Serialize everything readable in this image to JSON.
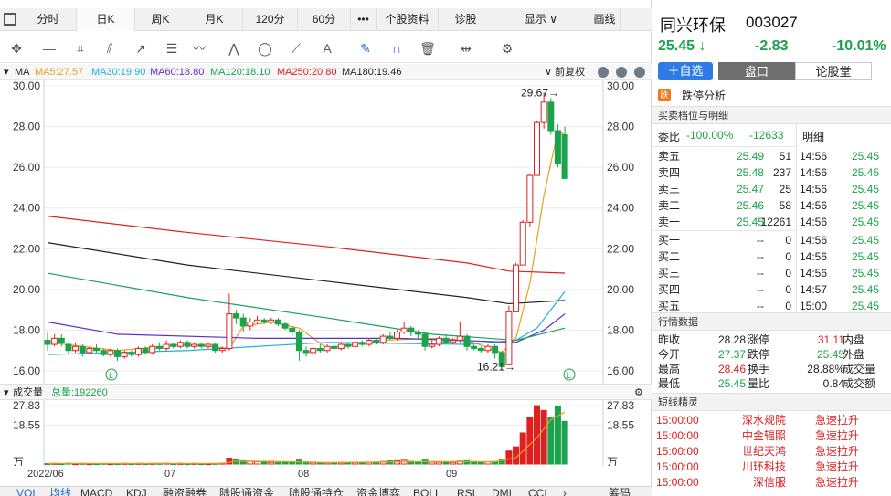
{
  "colors": {
    "up": "#e0201f",
    "down": "#1aa34a",
    "accent": "#2f7be6"
  },
  "period_tabs": [
    {
      "label": "分时"
    },
    {
      "label": "日K",
      "active": true
    },
    {
      "label": "周K"
    },
    {
      "label": "月K"
    },
    {
      "label": "120分"
    },
    {
      "label": "60分"
    },
    {
      "label": "•••"
    },
    {
      "label": "个股资料"
    },
    {
      "label": "诊股"
    },
    {
      "label": "显示 ∨"
    },
    {
      "label": "画线"
    }
  ],
  "drawing_tools": [
    "crosshair-icon",
    "segment-icon",
    "rectangle-icon",
    "channel-icon",
    "ray-icon",
    "parallel-icon",
    "text-icon",
    "polyline-icon",
    "ellipse-icon",
    "fibonacci-icon",
    "annotation-icon",
    "brush-icon",
    "magnet-icon",
    "trash-icon",
    "split-icon",
    "settings-icon"
  ],
  "ma_bar": {
    "label": "MA",
    "items": [
      {
        "text": "MA5:27.57",
        "color": "#e6a01e"
      },
      {
        "text": "MA30:19.90",
        "color": "#19b6d8"
      },
      {
        "text": "MA60:18.80",
        "color": "#5a30c8"
      },
      {
        "text": "MA120:18.10",
        "color": "#19a25a"
      },
      {
        "text": "MA250:20.80",
        "color": "#e0201f"
      },
      {
        "text": "MA180:19.46",
        "color": "#222222"
      }
    ],
    "adjust_label": "∨ 前复权"
  },
  "price_axis": {
    "ticks": [
      "30.00",
      "28.00",
      "26.00",
      "24.00",
      "22.00",
      "20.00",
      "18.00",
      "16.00"
    ]
  },
  "annotations": {
    "high": "29.67→",
    "low": "16.21→"
  },
  "volume_bar": {
    "label": "成交量",
    "total": "总量:192260"
  },
  "volume_axis": {
    "ticks": [
      "27.83",
      "18.55",
      "万"
    ]
  },
  "date_axis": [
    "2022/06",
    "07",
    "08",
    "09"
  ],
  "indicator_tabs": [
    "VOL",
    "均线",
    "MACD",
    "KDJ",
    "融资融券",
    "陆股通资金",
    "陆股通持仓",
    "资金博弈",
    "BOLL",
    "RSI",
    "DMI",
    "CCI",
    "›",
    "筹码"
  ],
  "chart_data": {
    "type": "candlestick",
    "ylim": [
      16,
      30
    ],
    "candles": [
      [
        17.5,
        17.3,
        17.9,
        17.0
      ],
      [
        17.3,
        17.6,
        17.8,
        17.2
      ],
      [
        17.6,
        17.4,
        17.8,
        17.2
      ],
      [
        17.3,
        17.0,
        17.4,
        16.8
      ],
      [
        17.0,
        17.2,
        17.4,
        16.9
      ],
      [
        17.2,
        16.9,
        17.3,
        16.7
      ],
      [
        16.9,
        17.1,
        17.2,
        16.8
      ],
      [
        17.1,
        17.0,
        17.3,
        16.9
      ],
      [
        17.0,
        16.8,
        17.1,
        16.7
      ],
      [
        16.8,
        17.0,
        17.1,
        16.7
      ],
      [
        17.0,
        16.7,
        17.1,
        16.5
      ],
      [
        16.7,
        16.9,
        17.0,
        16.6
      ],
      [
        16.9,
        16.8,
        17.0,
        16.7
      ],
      [
        16.8,
        17.1,
        17.2,
        16.7
      ],
      [
        17.1,
        16.9,
        17.2,
        16.8
      ],
      [
        16.9,
        17.2,
        17.3,
        16.8
      ],
      [
        17.2,
        17.1,
        17.4,
        17.0
      ],
      [
        17.1,
        17.3,
        17.5,
        17.0
      ],
      [
        17.3,
        17.2,
        17.4,
        17.1
      ],
      [
        17.2,
        17.4,
        17.5,
        17.1
      ],
      [
        17.4,
        17.2,
        17.5,
        17.1
      ],
      [
        17.2,
        17.3,
        17.4,
        17.1
      ],
      [
        17.3,
        17.2,
        17.4,
        17.1
      ],
      [
        17.2,
        17.3,
        17.4,
        17.1
      ],
      [
        17.3,
        17.0,
        17.4,
        16.9
      ],
      [
        17.0,
        17.1,
        17.2,
        16.9
      ],
      [
        17.1,
        18.8,
        19.8,
        17.0
      ],
      [
        18.8,
        18.6,
        19.0,
        18.3
      ],
      [
        18.6,
        18.2,
        18.8,
        17.9
      ],
      [
        18.2,
        18.4,
        18.6,
        18.0
      ],
      [
        18.4,
        18.5,
        18.7,
        18.3
      ],
      [
        18.5,
        18.4,
        18.6,
        18.3
      ],
      [
        18.4,
        18.5,
        18.6,
        18.3
      ],
      [
        18.5,
        18.3,
        18.6,
        18.2
      ],
      [
        18.3,
        18.1,
        18.4,
        18.0
      ],
      [
        18.1,
        17.9,
        18.2,
        17.7
      ],
      [
        17.9,
        17.0,
        18.0,
        16.5
      ],
      [
        17.0,
        16.9,
        17.2,
        16.7
      ],
      [
        16.9,
        17.1,
        17.2,
        16.8
      ],
      [
        17.1,
        17.0,
        17.3,
        16.9
      ],
      [
        17.0,
        17.2,
        17.3,
        16.9
      ],
      [
        17.2,
        17.1,
        17.3,
        17.0
      ],
      [
        17.1,
        17.3,
        17.4,
        17.0
      ],
      [
        17.3,
        17.2,
        17.4,
        17.1
      ],
      [
        17.2,
        17.4,
        17.5,
        17.1
      ],
      [
        17.4,
        17.3,
        17.5,
        17.2
      ],
      [
        17.3,
        17.5,
        17.6,
        17.2
      ],
      [
        17.5,
        17.4,
        17.6,
        17.3
      ],
      [
        17.4,
        17.7,
        17.8,
        17.3
      ],
      [
        17.7,
        17.6,
        17.9,
        17.5
      ],
      [
        17.6,
        17.9,
        18.0,
        17.5
      ],
      [
        17.9,
        18.1,
        18.4,
        17.8
      ],
      [
        18.1,
        17.9,
        18.2,
        17.7
      ],
      [
        17.9,
        17.8,
        18.0,
        17.6
      ],
      [
        17.8,
        17.2,
        17.9,
        17.0
      ],
      [
        17.2,
        17.3,
        17.5,
        17.1
      ],
      [
        17.3,
        17.6,
        17.7,
        17.2
      ],
      [
        17.6,
        17.4,
        17.8,
        17.3
      ],
      [
        17.4,
        17.5,
        17.6,
        17.3
      ],
      [
        17.5,
        17.7,
        18.4,
        17.4
      ],
      [
        17.7,
        17.2,
        17.8,
        17.0
      ],
      [
        17.2,
        17.1,
        17.3,
        17.0
      ],
      [
        17.1,
        17.0,
        17.2,
        16.9
      ],
      [
        17.0,
        17.2,
        17.3,
        16.9
      ],
      [
        17.2,
        16.9,
        17.3,
        16.6
      ],
      [
        16.9,
        16.21,
        17.0,
        16.21
      ],
      [
        16.3,
        18.9,
        19.2,
        16.3
      ],
      [
        18.9,
        21.2,
        21.3,
        18.9
      ],
      [
        21.2,
        23.3,
        23.4,
        21.2
      ],
      [
        23.3,
        25.6,
        25.7,
        23.1
      ],
      [
        25.6,
        28.2,
        28.3,
        25.6
      ],
      [
        28.2,
        29.2,
        29.67,
        27.9
      ],
      [
        29.2,
        27.8,
        29.4,
        27.6
      ],
      [
        27.8,
        26.2,
        28.1,
        26.0
      ],
      [
        27.6,
        25.45,
        28.0,
        25.45
      ]
    ],
    "ma_lines": {
      "MA5": [
        [
          0,
          17.4
        ],
        [
          10,
          17.0
        ],
        [
          20,
          17.3
        ],
        [
          26,
          17.1
        ],
        [
          28,
          18.2
        ],
        [
          32,
          18.4
        ],
        [
          36,
          18.1
        ],
        [
          40,
          17.1
        ],
        [
          48,
          17.5
        ],
        [
          55,
          17.6
        ],
        [
          60,
          17.5
        ],
        [
          65,
          16.9
        ],
        [
          67,
          17.6
        ],
        [
          69,
          20.3
        ],
        [
          71,
          24.6
        ],
        [
          73,
          27.8
        ],
        [
          74,
          27.57
        ]
      ],
      "MA30": [
        [
          0,
          16.8
        ],
        [
          20,
          17.0
        ],
        [
          40,
          17.4
        ],
        [
          60,
          17.3
        ],
        [
          67,
          17.5
        ],
        [
          70,
          18.1
        ],
        [
          74,
          19.9
        ]
      ],
      "MA60": [
        [
          0,
          18.4
        ],
        [
          10,
          17.8
        ],
        [
          30,
          17.6
        ],
        [
          50,
          17.6
        ],
        [
          67,
          17.4
        ],
        [
          71,
          18.0
        ],
        [
          74,
          18.8
        ]
      ],
      "MA120": [
        [
          0,
          20.8
        ],
        [
          20,
          19.6
        ],
        [
          40,
          18.6
        ],
        [
          55,
          17.8
        ],
        [
          67,
          17.5
        ],
        [
          74,
          18.1
        ]
      ],
      "MA250": [
        [
          0,
          23.6
        ],
        [
          20,
          22.8
        ],
        [
          40,
          22.1
        ],
        [
          60,
          21.3
        ],
        [
          66,
          20.9
        ],
        [
          74,
          20.8
        ]
      ],
      "MA180": [
        [
          0,
          22.3
        ],
        [
          20,
          21.2
        ],
        [
          40,
          20.4
        ],
        [
          60,
          19.6
        ],
        [
          66,
          19.3
        ],
        [
          74,
          19.46
        ]
      ]
    },
    "volume": {
      "ylim": [
        0,
        27.83
      ],
      "bars": [
        0.2,
        0.3,
        0.2,
        0.4,
        0.2,
        0.3,
        0.2,
        0.2,
        0.3,
        0.2,
        0.2,
        0.3,
        0.2,
        0.3,
        0.2,
        0.3,
        0.3,
        0.4,
        0.2,
        0.3,
        0.2,
        0.3,
        0.2,
        0.2,
        0.3,
        0.4,
        2.8,
        2.2,
        1.6,
        1.4,
        1.1,
        0.9,
        0.8,
        0.7,
        0.8,
        0.9,
        1.9,
        1.0,
        0.7,
        0.6,
        0.6,
        0.5,
        0.6,
        0.7,
        0.7,
        0.6,
        0.8,
        0.9,
        1.2,
        1.5,
        1.6,
        1.8,
        1.3,
        1.0,
        1.9,
        1.0,
        0.9,
        1.0,
        0.8,
        1.4,
        1.6,
        1.2,
        1.0,
        1.1,
        1.2,
        2.4,
        6.2,
        8.2,
        14.8,
        22.3,
        27.8,
        25.5,
        22.4,
        27.6,
        20.3
      ],
      "ma": [
        [
          0,
          0.3
        ],
        [
          25,
          0.3
        ],
        [
          27,
          1.3
        ],
        [
          32,
          1.3
        ],
        [
          40,
          0.7
        ],
        [
          55,
          1.2
        ],
        [
          64,
          1.1
        ],
        [
          67,
          3.0
        ],
        [
          70,
          12.5
        ],
        [
          72,
          21.0
        ],
        [
          74,
          24.8
        ]
      ]
    },
    "labels": {
      "high": "29.67",
      "low": "16.21"
    }
  },
  "stock": {
    "name": "同兴环保",
    "code": "003027",
    "price": "25.45 ↓",
    "change": "-2.83",
    "pct": "-10.01%"
  },
  "actions": {
    "add_watch": "＋自选",
    "tab_quote": "盘口",
    "tab_forum": "论股堂"
  },
  "limit_analysis": "跌停分析",
  "orderbook_title": "买卖档位与明细",
  "weibi": {
    "label": "委比",
    "pct": "-100.00%",
    "diff": "-12633",
    "detail_label": "明细"
  },
  "orderbook": [
    {
      "label": "卖五",
      "price": "25.49",
      "vol": "51",
      "pc": "green"
    },
    {
      "label": "卖四",
      "price": "25.48",
      "vol": "237",
      "pc": "green"
    },
    {
      "label": "卖三",
      "price": "25.47",
      "vol": "25",
      "pc": "green"
    },
    {
      "label": "卖二",
      "price": "25.46",
      "vol": "58",
      "pc": "green"
    },
    {
      "label": "卖一",
      "price": "25.45",
      "vol": "12261",
      "pc": "green"
    },
    {
      "label": "买一",
      "price": "--",
      "vol": "0",
      "pc": "dark"
    },
    {
      "label": "买二",
      "price": "--",
      "vol": "0",
      "pc": "dark"
    },
    {
      "label": "买三",
      "price": "--",
      "vol": "0",
      "pc": "dark"
    },
    {
      "label": "买四",
      "price": "--",
      "vol": "0",
      "pc": "dark"
    },
    {
      "label": "买五",
      "price": "--",
      "vol": "0",
      "pc": "dark"
    }
  ],
  "ticks": [
    {
      "time": "14:56",
      "price": "25.45"
    },
    {
      "time": "14:56",
      "price": "25.45"
    },
    {
      "time": "14:56",
      "price": "25.45"
    },
    {
      "time": "14:56",
      "price": "25.45"
    },
    {
      "time": "14:56",
      "price": "25.45"
    },
    {
      "time": "14:56",
      "price": "25.45"
    },
    {
      "time": "14:56",
      "price": "25.45"
    },
    {
      "time": "14:56",
      "price": "25.45"
    },
    {
      "time": "14:57",
      "price": "25.45"
    },
    {
      "time": "15:00",
      "price": "25.45"
    }
  ],
  "stats_title": "行情数据",
  "stats": [
    [
      {
        "t": "昨收",
        "c": "dark"
      },
      {
        "t": "28.28",
        "c": "dark"
      },
      {
        "t": "涨停",
        "c": "dark"
      },
      {
        "t": "31.11",
        "c": "red"
      },
      {
        "t": "内盘",
        "c": "dark"
      }
    ],
    [
      {
        "t": "今开",
        "c": "dark"
      },
      {
        "t": "27.37",
        "c": "green"
      },
      {
        "t": "跌停",
        "c": "dark"
      },
      {
        "t": "25.45",
        "c": "green"
      },
      {
        "t": "外盘",
        "c": "dark"
      }
    ],
    [
      {
        "t": "最高",
        "c": "dark"
      },
      {
        "t": "28.46",
        "c": "red"
      },
      {
        "t": "换手",
        "c": "dark"
      },
      {
        "t": "28.88%",
        "c": "dark"
      },
      {
        "t": "成交量",
        "c": "dark"
      }
    ],
    [
      {
        "t": "最低",
        "c": "dark"
      },
      {
        "t": "25.45",
        "c": "green"
      },
      {
        "t": "量比",
        "c": "dark"
      },
      {
        "t": "0.84",
        "c": "dark"
      },
      {
        "t": "成交额",
        "c": "dark"
      }
    ]
  ],
  "news_title": "短线精灵",
  "news": [
    {
      "time": "15:00:00",
      "name": "深水规院",
      "event": "急速拉升"
    },
    {
      "time": "15:00:00",
      "name": "中金辐照",
      "event": "急速拉升"
    },
    {
      "time": "15:00:00",
      "name": "世纪天鸿",
      "event": "急速拉升"
    },
    {
      "time": "15:00:00",
      "name": "川环科技",
      "event": "急速拉升"
    },
    {
      "time": "15:00:00",
      "name": "深信服",
      "event": "急速拉升"
    }
  ]
}
